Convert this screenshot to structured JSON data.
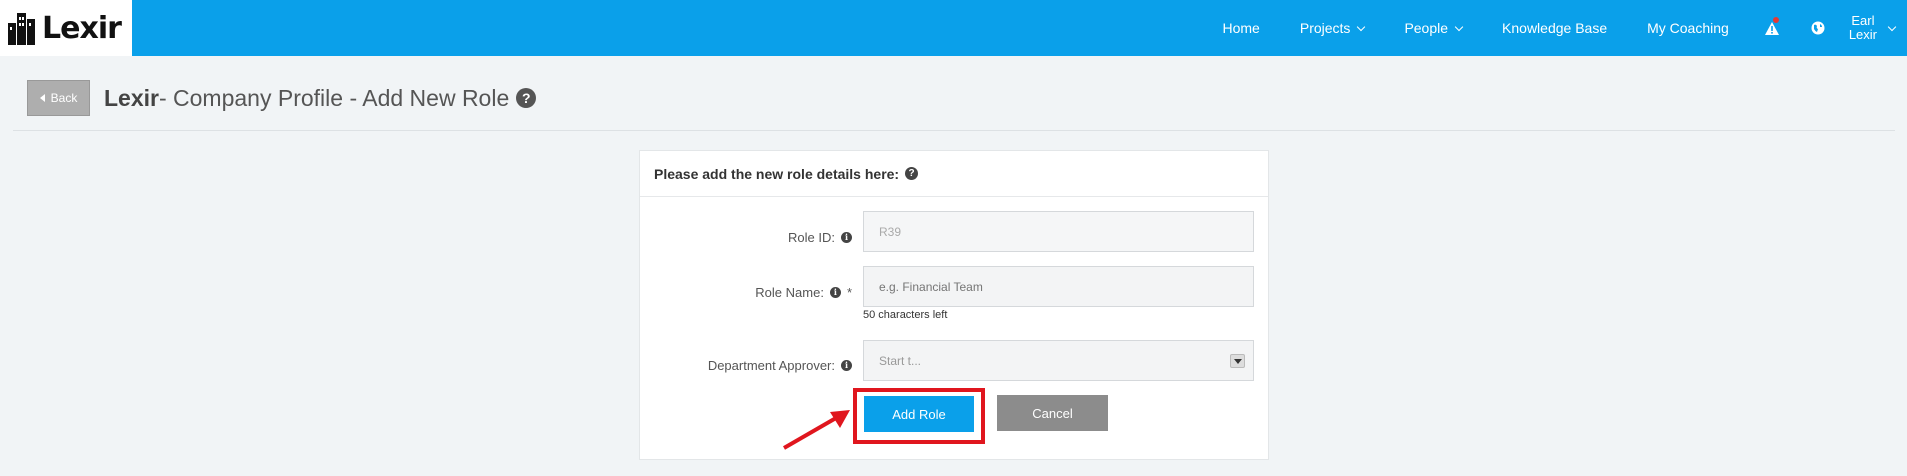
{
  "brand": {
    "logo_text": "Lexir"
  },
  "nav": {
    "items": [
      {
        "label": "Home",
        "dropdown": false
      },
      {
        "label": "Projects",
        "dropdown": true
      },
      {
        "label": "People",
        "dropdown": true
      },
      {
        "label": "Knowledge Base",
        "dropdown": false
      },
      {
        "label": "My Coaching",
        "dropdown": false
      }
    ],
    "alert_icon": "warning-triangle-icon",
    "globe_icon": "globe-icon",
    "user": {
      "first": "Earl",
      "last": "Lexir"
    }
  },
  "header": {
    "back_label": "Back",
    "company": "Lexir",
    "title_rest": "- Company Profile - Add New Role"
  },
  "form": {
    "heading": "Please add the new role details here:",
    "role_id": {
      "label": "Role ID:",
      "value": "R39"
    },
    "role_name": {
      "label": "Role Name:",
      "required_mark": "*",
      "placeholder": "e.g. Financial Team",
      "hint": "50 characters left"
    },
    "approver": {
      "label": "Department Approver:",
      "placeholder": "Start t..."
    },
    "add_button": "Add Role",
    "cancel_button": "Cancel"
  },
  "colors": {
    "primary": "#0aa0ea",
    "cancel": "#8c8c8c",
    "highlight": "#e0161e"
  }
}
